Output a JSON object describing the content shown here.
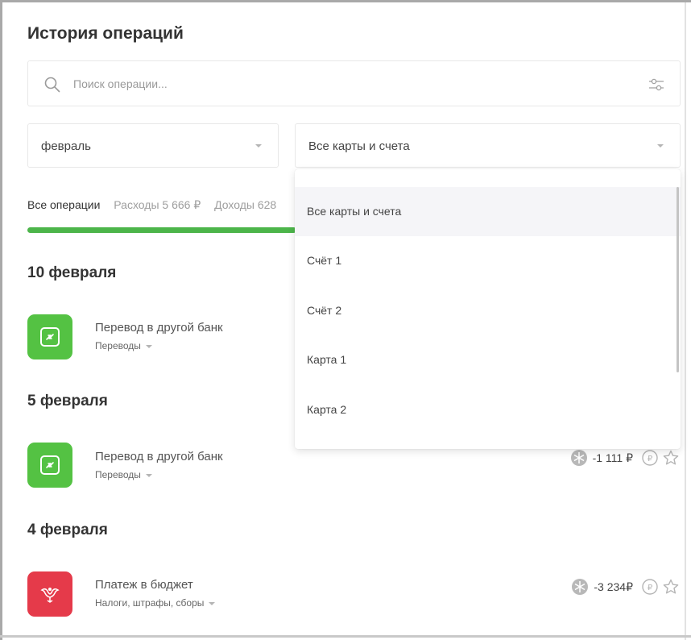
{
  "page": {
    "title": "История операций"
  },
  "search": {
    "placeholder": "Поиск операции..."
  },
  "filters": {
    "month": "февраль",
    "cards": "Все карты и счета"
  },
  "tabs": [
    {
      "label": "Все операции",
      "active": true
    },
    {
      "label": "Расходы 5 666 ₽",
      "active": false
    },
    {
      "label": "Доходы 628",
      "active": false
    }
  ],
  "groups": [
    {
      "date": "10 февраля",
      "operation": {
        "name": "Перевод в другой банк",
        "category": "Переводы",
        "icon": "transfer-icon",
        "color": "#54c243"
      }
    },
    {
      "date": "5 февраля",
      "operation": {
        "name": "Перевод в другой банк",
        "category": "Переводы",
        "icon": "transfer-icon",
        "color": "#54c243",
        "amount": "-1 111 ₽"
      }
    },
    {
      "date": "4 февраля",
      "operation": {
        "name": "Платеж в бюджет",
        "category": "Налоги, штрафы, сборы",
        "icon": "emblem-icon",
        "color": "#e53a4a",
        "amount": "-3 234₽"
      }
    }
  ],
  "dropdown": {
    "options": [
      "Все карты и счета",
      "Счёт 1",
      "Счёт 2",
      "Карта 1",
      "Карта 2"
    ],
    "selected": "Все карты и счета"
  },
  "colors": {
    "accent_green": "#4cb54a",
    "budget_red": "#e53a4a",
    "transfer_green": "#54c243"
  }
}
